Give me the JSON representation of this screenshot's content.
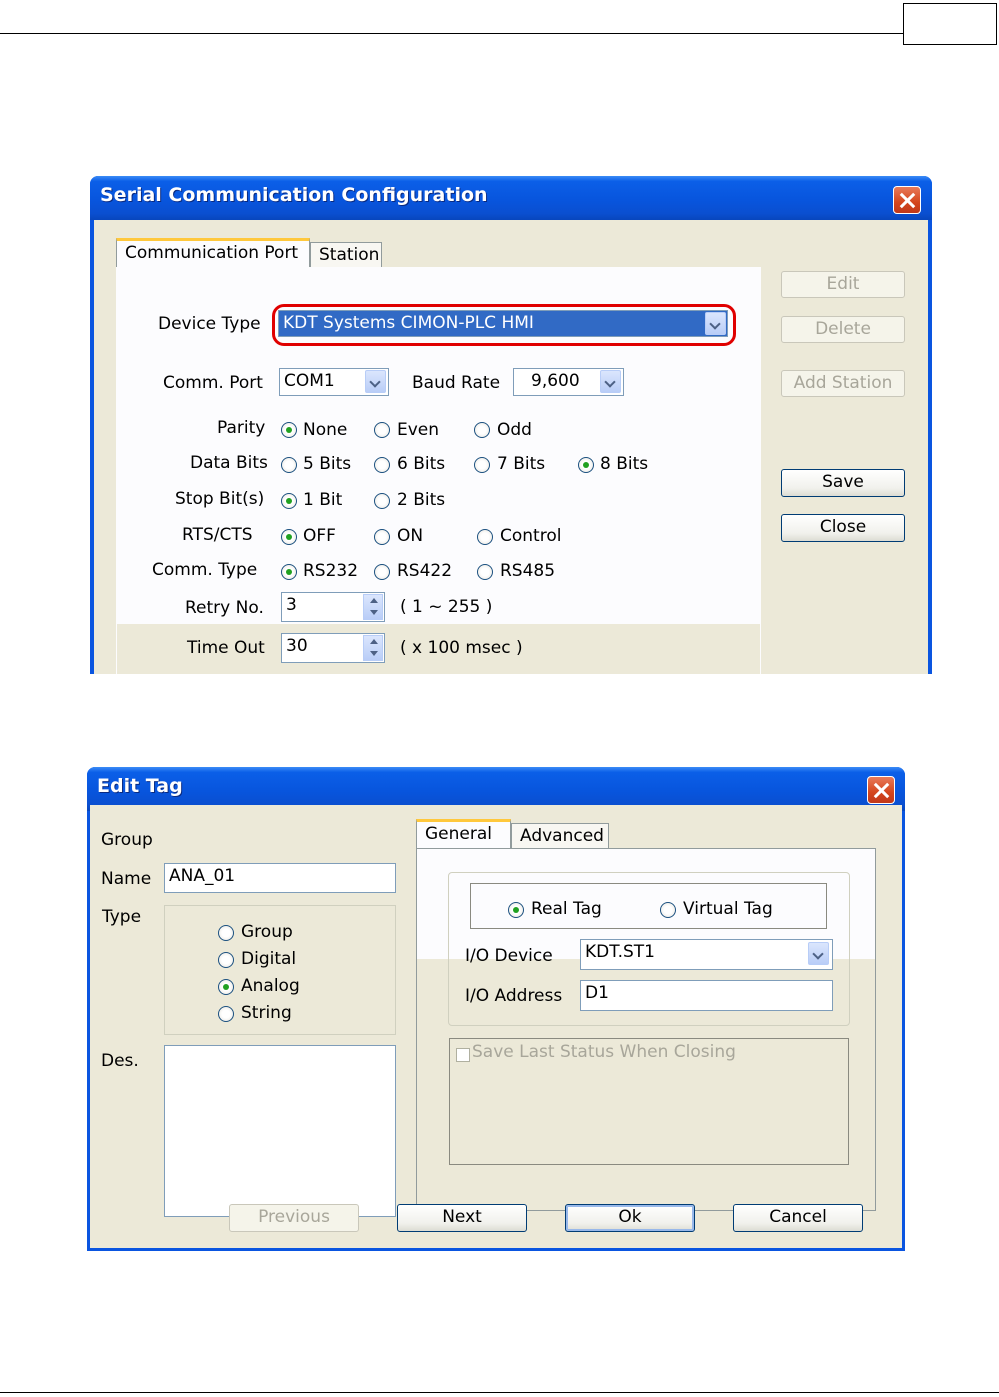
{
  "dialog1": {
    "title": "Serial Communication Configuration",
    "tabs": [
      "Communication Port",
      "Station"
    ],
    "device_type_label": "Device Type",
    "device_type_value": "KDT Systems CIMON-PLC HMI",
    "comm_port_label": "Comm. Port",
    "comm_port_value": "COM1",
    "baud_rate_label": "Baud Rate",
    "baud_rate_value": "9,600",
    "parity_label": "Parity",
    "parity_options": [
      "None",
      "Even",
      "Odd"
    ],
    "data_bits_label": "Data Bits",
    "data_bits_options": [
      "5 Bits",
      "6 Bits",
      "7 Bits",
      "8 Bits"
    ],
    "stop_bits_label": "Stop Bit(s)",
    "stop_bits_options": [
      "1 Bit",
      "2 Bits"
    ],
    "rts_cts_label": "RTS/CTS",
    "rts_cts_options": [
      "OFF",
      "ON",
      "Control"
    ],
    "comm_type_label": "Comm. Type",
    "comm_type_options": [
      "RS232",
      "RS422",
      "RS485"
    ],
    "retry_label": "Retry No.",
    "retry_value": "3",
    "retry_range": "( 1 ~ 255 )",
    "timeout_label": "Time Out",
    "timeout_value": "30",
    "timeout_unit": "( x 100 msec )",
    "buttons": {
      "edit": "Edit",
      "delete": "Delete",
      "add_station": "Add Station",
      "save": "Save",
      "close": "Close"
    }
  },
  "dialog2": {
    "title": "Edit Tag",
    "group_label": "Group",
    "name_label": "Name",
    "name_value": "ANA_01",
    "type_label": "Type",
    "type_options": [
      "Group",
      "Digital",
      "Analog",
      "String"
    ],
    "des_label": "Des.",
    "tabs": [
      "General",
      "Advanced"
    ],
    "tag_kind_options": [
      "Real Tag",
      "Virtual Tag"
    ],
    "io_device_label": "I/O Device",
    "io_device_value": "KDT.ST1",
    "io_address_label": "I/O Address",
    "io_address_value": "D1",
    "save_last_status": "Save Last Status When Closing",
    "buttons": {
      "previous": "Previous",
      "next": "Next",
      "ok": "Ok",
      "cancel": "Cancel"
    }
  },
  "colors": {
    "title_blue": "#0855dd",
    "highlight_red": "#e00000",
    "radio_green": "#21a121",
    "dialog_bg": "#ece9d8"
  }
}
